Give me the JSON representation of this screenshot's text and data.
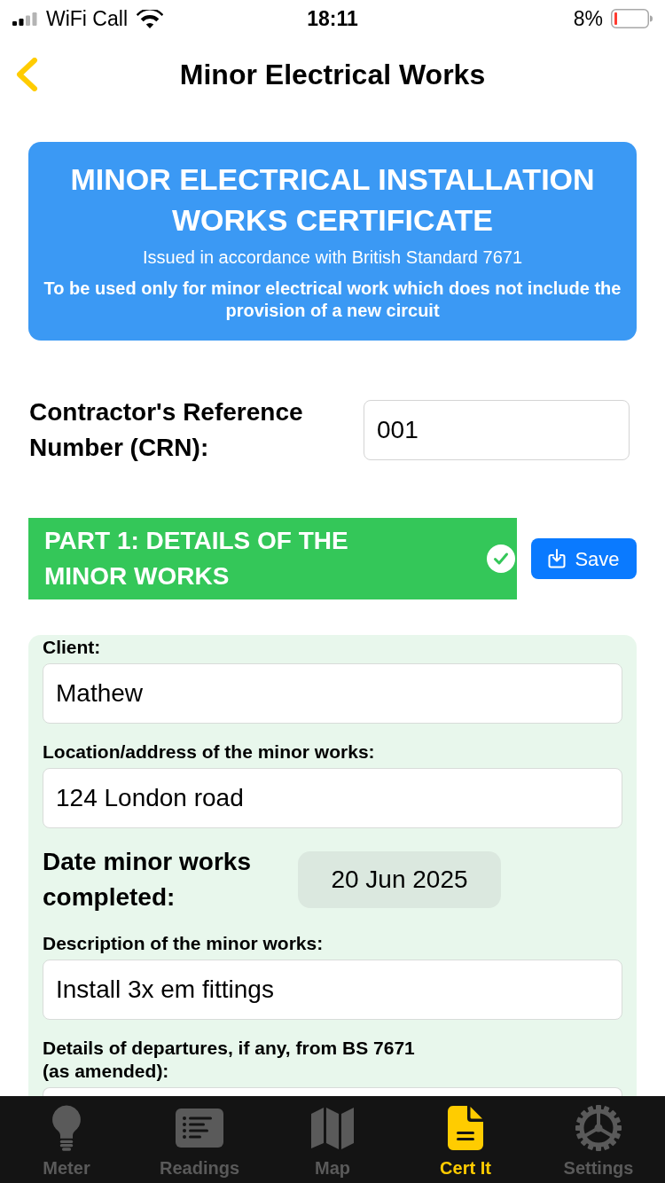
{
  "status_bar": {
    "carrier": "WiFi Call",
    "time": "18:11",
    "battery": "8%"
  },
  "nav": {
    "title": "Minor Electrical Works"
  },
  "banner": {
    "title": "MINOR ELECTRICAL INSTALLATION WORKS CERTIFICATE",
    "subtitle": "Issued in accordance with British Standard 7671",
    "note": "To be used only for minor electrical work which does not include the provision of a new circuit"
  },
  "crn": {
    "label": "Contractor's Reference Number (CRN):",
    "value": "001"
  },
  "section": {
    "title": "PART 1: DETAILS OF THE MINOR WORKS",
    "complete": true,
    "save_button": "Save"
  },
  "fields": [
    {
      "kind": "text",
      "label": "Client:",
      "value": "Mathew"
    },
    {
      "kind": "text",
      "label": "Location/address of the minor works:",
      "value": "124 London road"
    },
    {
      "kind": "date",
      "label": "Date minor works completed:",
      "value": "20 Jun 2025"
    },
    {
      "kind": "text",
      "label": "Description of the minor works:",
      "value": "Install 3x em fittings"
    },
    {
      "kind": "text",
      "label": "Details of departures, if any, from BS 7671 (as amended):"
    }
  ],
  "tab_bar": [
    {
      "label": "Meter",
      "selected": false
    },
    {
      "label": "Readings",
      "selected": false
    },
    {
      "label": "Map",
      "selected": false
    },
    {
      "label": "Cert It",
      "selected": true
    },
    {
      "label": "Settings",
      "selected": false
    }
  ]
}
